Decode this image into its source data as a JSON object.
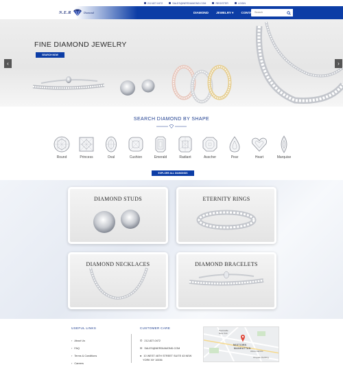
{
  "topbar": {
    "phone": "212-827-0472",
    "email": "SALES@NERDIAMOND.COM",
    "register": "REGISTER",
    "login": "LOGIN"
  },
  "header": {
    "logo_main": "N.E.R",
    "logo_sub": "Diamond",
    "nav": [
      {
        "label": "DIAMOND"
      },
      {
        "label": "JEWELRY ▾"
      },
      {
        "label": "CONTACT"
      }
    ],
    "search_placeholder": "Search"
  },
  "hero": {
    "title": "FINE DIAMOND JEWELRY",
    "button": "SEARCH NOW",
    "prev": "‹",
    "next": "›"
  },
  "shapes": {
    "title": "SEARCH DIAMOND BY SHAPE",
    "items": [
      {
        "label": "Round",
        "icon": "round-diamond-icon"
      },
      {
        "label": "Princess",
        "icon": "princess-diamond-icon"
      },
      {
        "label": "Oval",
        "icon": "oval-diamond-icon"
      },
      {
        "label": "Cushion",
        "icon": "cushion-diamond-icon"
      },
      {
        "label": "Emerald",
        "icon": "emerald-diamond-icon"
      },
      {
        "label": "Radiant",
        "icon": "radiant-diamond-icon"
      },
      {
        "label": "Asscher",
        "icon": "asscher-diamond-icon"
      },
      {
        "label": "Pear",
        "icon": "pear-diamond-icon"
      },
      {
        "label": "Heart",
        "icon": "heart-diamond-icon"
      },
      {
        "label": "Marquise",
        "icon": "marquise-diamond-icon"
      }
    ],
    "explore_button": "EXPLORE ALL DIAMONDS"
  },
  "collections": [
    {
      "title": "DIAMOND STUDS"
    },
    {
      "title": "ETERNITY RINGS"
    },
    {
      "title": "DIAMOND NECKLACES"
    },
    {
      "title": "DIAMOND BRACELETS"
    }
  ],
  "footer": {
    "useful_links_title": "USEFUL LINKS",
    "links": [
      "About Us",
      "FAQ",
      "Terms & Conditions",
      "Careers"
    ],
    "customer_care_title": "CUSTOMER CARE",
    "phone": "212-827-0472",
    "email": "SALES@NERDIAMOND.COM",
    "address_line1": "10 WEST 46TH STREET SUITE 43 NEW",
    "address_line2": "YORK NY 10036",
    "map_labels": [
      "Townsville",
      "New York",
      "MIDTOWN",
      "MANHATTAN",
      "About Fabrics",
      "Chrysler Building"
    ]
  },
  "colors": {
    "brand_blue": "#0c3da6",
    "heading_blue": "#1d3d8f"
  }
}
